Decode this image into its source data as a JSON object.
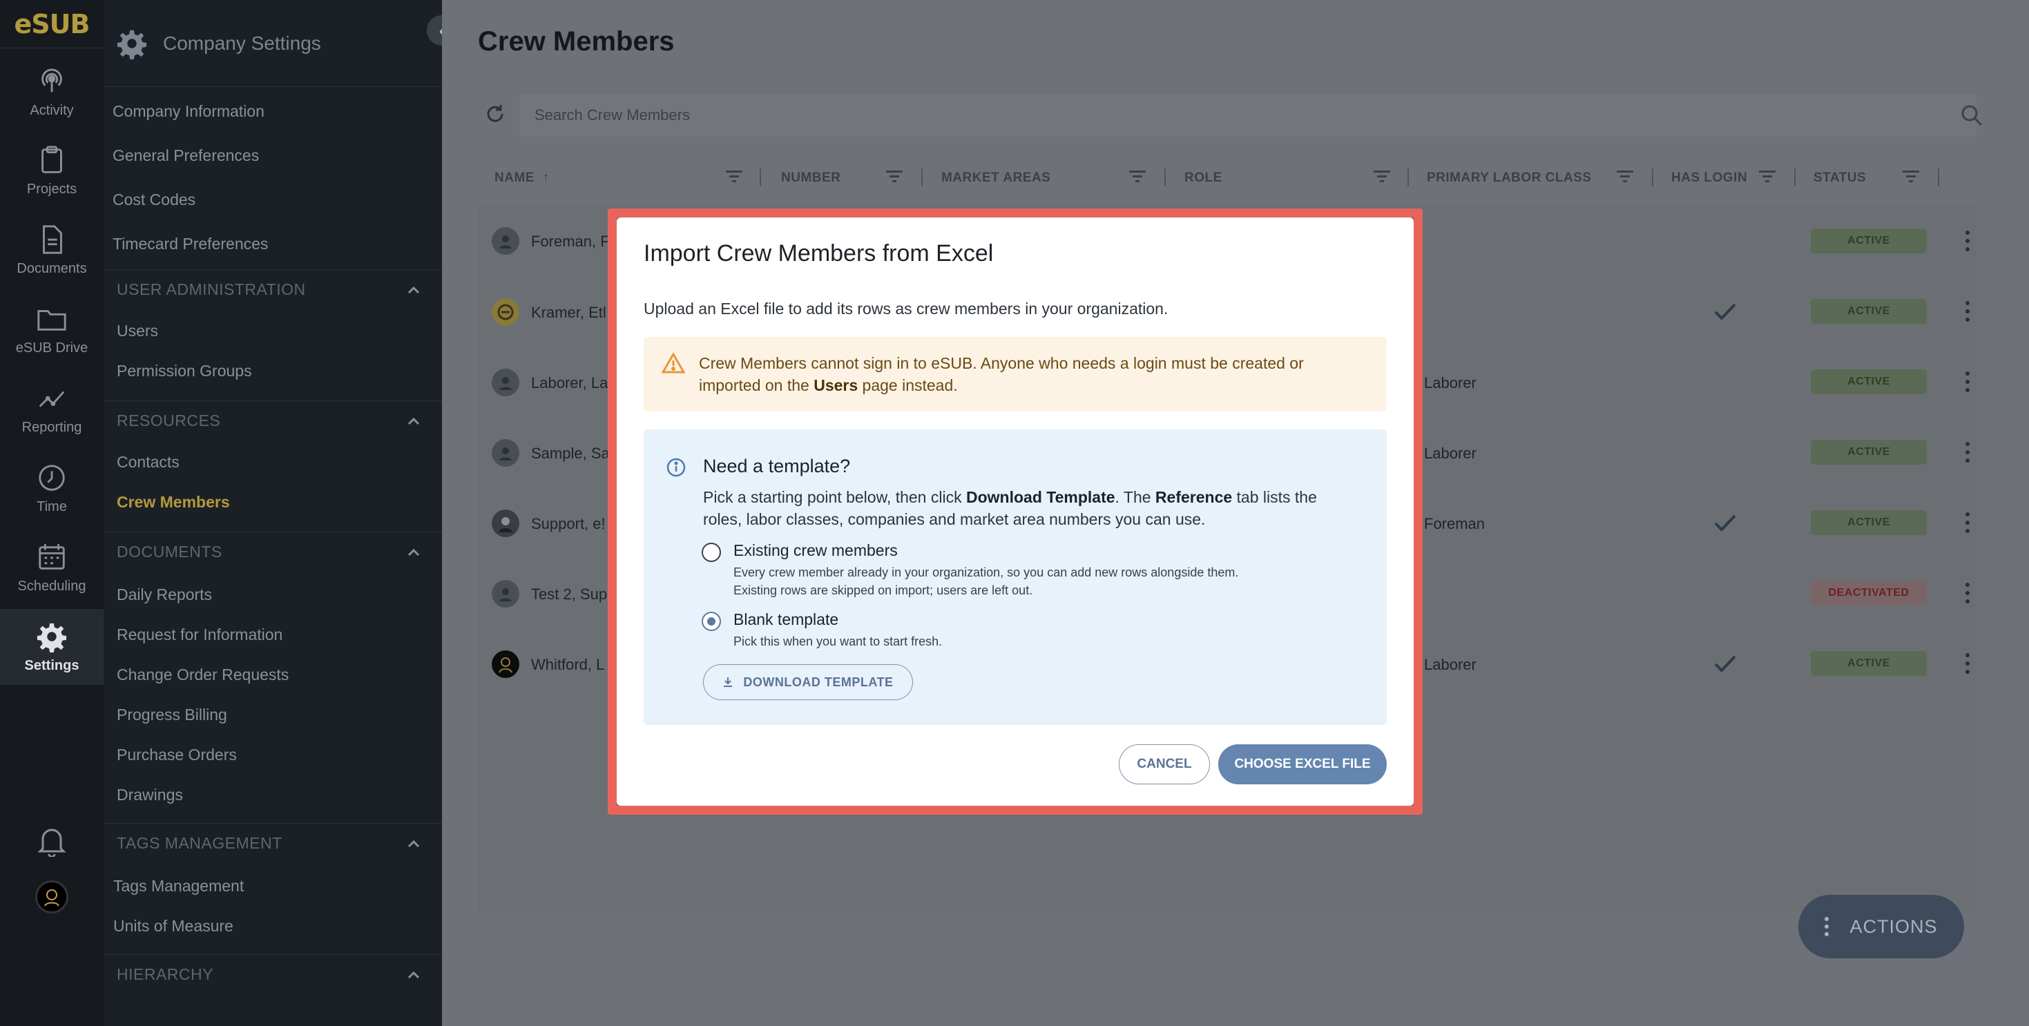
{
  "app": {
    "logo": "eSUB"
  },
  "rail": {
    "items": [
      {
        "label": "Activity",
        "icon": "activity-icon"
      },
      {
        "label": "Projects",
        "icon": "clipboard-icon"
      },
      {
        "label": "Documents",
        "icon": "document-icon"
      },
      {
        "label": "eSUB Drive",
        "icon": "folder-icon"
      },
      {
        "label": "Reporting",
        "icon": "chart-icon"
      },
      {
        "label": "Time",
        "icon": "clock-icon"
      },
      {
        "label": "Scheduling",
        "icon": "calendar-icon"
      },
      {
        "label": "Settings",
        "icon": "gear-icon"
      }
    ]
  },
  "panel": {
    "title": "Company Settings",
    "top_links": [
      "Company Information",
      "General Preferences",
      "Cost Codes",
      "Timecard Preferences"
    ],
    "sections": [
      {
        "title": "USER ADMINISTRATION",
        "items": [
          "Users",
          "Permission Groups"
        ]
      },
      {
        "title": "RESOURCES",
        "items": [
          "Contacts",
          "Crew Members"
        ]
      },
      {
        "title": "DOCUMENTS",
        "items": [
          "Daily Reports",
          "Request for Information",
          "Change Order Requests",
          "Progress Billing",
          "Purchase Orders",
          "Drawings"
        ]
      },
      {
        "title": "TAGS MANAGEMENT",
        "items": [
          "Tags Management",
          "Units of Measure"
        ]
      },
      {
        "title": "HIERARCHY",
        "items": []
      }
    ],
    "current": "Crew Members"
  },
  "main": {
    "title": "Crew Members",
    "search_placeholder": "Search Crew Members",
    "columns": [
      "NAME",
      "NUMBER",
      "MARKET AREAS",
      "ROLE",
      "PRIMARY LABOR CLASS",
      "HAS LOGIN",
      "STATUS"
    ],
    "rows": [
      {
        "name": "Foreman, F",
        "labor": "",
        "login": false,
        "status": "ACTIVE"
      },
      {
        "name": "Kramer, Etl",
        "labor": "",
        "login": true,
        "status": "ACTIVE"
      },
      {
        "name": "Laborer, La",
        "labor": "Laborer",
        "login": false,
        "status": "ACTIVE"
      },
      {
        "name": "Sample, Sa",
        "labor": "Laborer",
        "login": false,
        "status": "ACTIVE"
      },
      {
        "name": "Support, e!",
        "labor": "Foreman",
        "login": true,
        "status": "ACTIVE"
      },
      {
        "name": "Test 2, Sup",
        "labor": "",
        "login": false,
        "status": "DEACTIVATED"
      },
      {
        "name": "Whitford, L",
        "labor": "Laborer",
        "login": true,
        "status": "ACTIVE"
      }
    ],
    "actions_label": "ACTIONS"
  },
  "modal": {
    "title": "Import Crew Members from Excel",
    "subtitle": "Upload an Excel file to add its rows as crew members in your organization.",
    "warning": {
      "before": "Crew Members cannot sign in to eSUB. Anyone who needs a login must be created or imported on the ",
      "bold": "Users",
      "after": " page instead."
    },
    "info": {
      "title": "Need a template?",
      "t1": "Pick a starting point below, then click ",
      "b1": "Download Template",
      "t2": ". The ",
      "b2": "Reference",
      "t3": " tab lists the roles, labor classes, companies and market area numbers you can use."
    },
    "options": [
      {
        "label": "Existing crew members",
        "desc1": "Every crew member already in your organization, so you can add new rows alongside them.",
        "desc2": "Existing rows are skipped on import; users are left out.",
        "checked": false
      },
      {
        "label": "Blank template",
        "desc1": "Pick this when you want to start fresh.",
        "desc2": "",
        "checked": true
      }
    ],
    "download_label": "DOWNLOAD TEMPLATE",
    "cancel_label": "CANCEL",
    "choose_label": "CHOOSE EXCEL FILE"
  },
  "colors": {
    "accent": "#b39a3c",
    "modal_outline": "#e8645a",
    "primary_button": "#6486b0"
  }
}
